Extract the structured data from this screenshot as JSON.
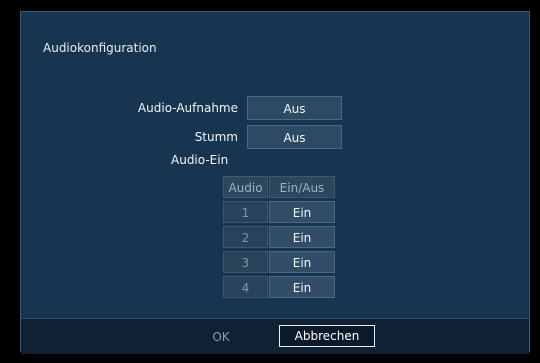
{
  "dialog": {
    "title": "Audiokonfiguration",
    "audio_record_label": "Audio-Aufnahme",
    "audio_record_value": "Aus",
    "mute_label": "Stumm",
    "mute_value": "Aus",
    "audio_in_label": "Audio-Ein"
  },
  "audio_table": {
    "headers": [
      "Audio",
      "Ein/Aus"
    ],
    "rows": [
      {
        "channel": "1",
        "state": "Ein"
      },
      {
        "channel": "2",
        "state": "Ein"
      },
      {
        "channel": "3",
        "state": "Ein"
      },
      {
        "channel": "4",
        "state": "Ein"
      }
    ]
  },
  "footer": {
    "ok_label": "OK",
    "cancel_label": "Abbrechen"
  }
}
